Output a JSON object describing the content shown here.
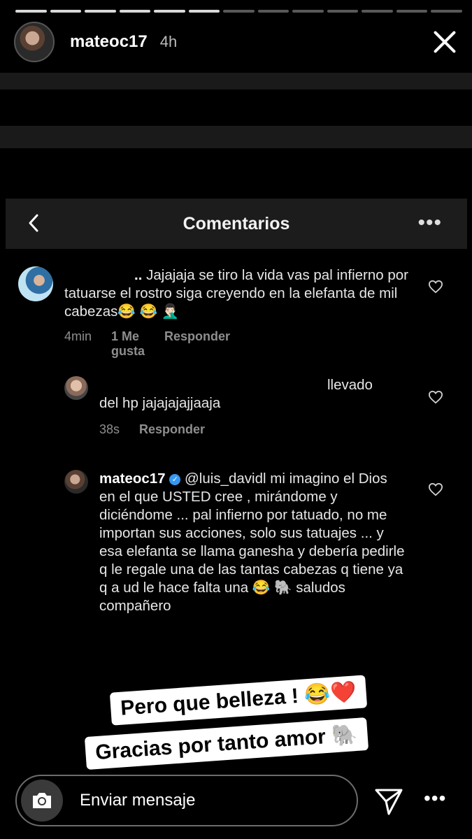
{
  "story": {
    "username": "mateoc17",
    "time": "4h",
    "segments": 13,
    "segments_viewed": 6
  },
  "comments_header": {
    "title": "Comentarios",
    "more": "•••"
  },
  "comments": [
    {
      "name_prefix": "..",
      "text": "Jajajaja se tiro la vida vas pal infierno por tatuarse el rostro siga creyendo en la elefanta de mil cabezas😂 😂 🤦🏻‍♂️",
      "time": "4min",
      "likes": "1 Me gusta",
      "reply": "Responder"
    },
    {
      "text_fragment": "llevado",
      "text": "del hp jajajajajjaaja",
      "time": "38s",
      "reply": "Responder"
    },
    {
      "username": "mateoc17",
      "mention": "@luis_davidl",
      "text": "mi imagino el Dios en el que USTED cree , mirándome y diciéndome ... pal infierno por tatuado, no me importan sus acciones,  solo sus tatuajes ... y esa elefanta se llama ganesha y debería pedirle q le regale una de las tantas cabezas q tiene ya q a ud le hace falta una  😂  🐘  saludos compañero"
    }
  ],
  "stickers": {
    "line1": "Pero que belleza ! 😂❤️",
    "line2": "Gracias por tanto amor 🐘"
  },
  "reply": {
    "placeholder": "Enviar mensaje",
    "more": "•••"
  }
}
